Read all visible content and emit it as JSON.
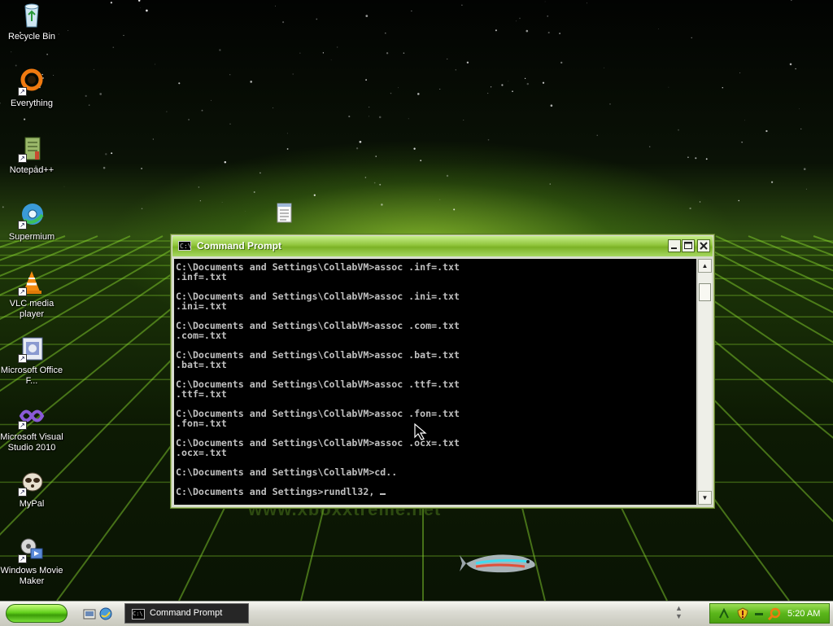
{
  "desktop": {
    "icons": [
      {
        "label": "Recycle Bin",
        "icon": "recycle-bin-icon"
      },
      {
        "label": "Everything",
        "icon": "everything-search-icon"
      },
      {
        "label": "Notepad++",
        "icon": "notepad-plus-plus-icon"
      },
      {
        "label": "Supermium",
        "icon": "supermium-browser-icon"
      },
      {
        "label": "VLC media player",
        "icon": "vlc-cone-icon"
      },
      {
        "label": "Microsoft Office F...",
        "icon": "office-document-icon"
      },
      {
        "label": "Microsoft Visual Studio 2010",
        "icon": "visual-studio-icon"
      },
      {
        "label": "MyPal",
        "icon": "mypal-browser-icon"
      },
      {
        "label": "Windows Movie Maker",
        "icon": "movie-maker-icon"
      }
    ],
    "watermark": "www.xboxxtreme.net"
  },
  "window": {
    "title": "Command Prompt",
    "icon_text": "C:\\",
    "console_lines": [
      "C:\\Documents and Settings\\CollabVM>assoc .inf=.txt",
      ".inf=.txt",
      "",
      "C:\\Documents and Settings\\CollabVM>assoc .ini=.txt",
      ".ini=.txt",
      "",
      "C:\\Documents and Settings\\CollabVM>assoc .com=.txt",
      ".com=.txt",
      "",
      "C:\\Documents and Settings\\CollabVM>assoc .bat=.txt",
      ".bat=.txt",
      "",
      "C:\\Documents and Settings\\CollabVM>assoc .ttf=.txt",
      ".ttf=.txt",
      "",
      "C:\\Documents and Settings\\CollabVM>assoc .fon=.txt",
      ".fon=.txt",
      "",
      "C:\\Documents and Settings\\CollabVM>assoc .ocx=.txt",
      ".ocx=.txt",
      "",
      "C:\\Documents and Settings\\CollabVM>cd..",
      ""
    ],
    "current_input": "C:\\Documents and Settings>rundll32, ",
    "scroll_up": "▲",
    "scroll_down": "▼"
  },
  "taskbar": {
    "task_label": "Command Prompt",
    "clock": "5:20 AM"
  }
}
